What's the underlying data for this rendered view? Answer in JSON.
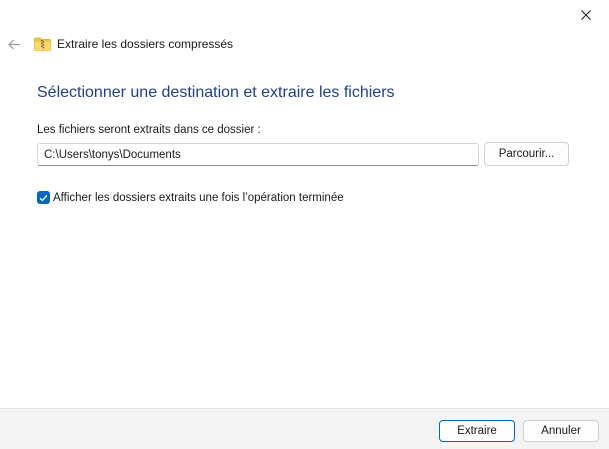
{
  "window": {
    "title": "Extraire les dossiers compressés",
    "close_icon": "close-icon",
    "back_icon": "back-arrow-icon",
    "folder_icon": "zip-folder-icon"
  },
  "main": {
    "heading": "Sélectionner une destination et extraire les fichiers",
    "destination_label": "Les fichiers seront extraits dans ce dossier :",
    "destination_value": "C:\\Users\\tonys\\Documents",
    "browse_label": "Parcourir...",
    "show_extracted_label": "Afficher les dossiers extraits une fois l’opération terminée",
    "show_extracted_checked": true
  },
  "footer": {
    "extract_label": "Extraire",
    "cancel_label": "Annuler"
  },
  "colors": {
    "accent": "#0067c0",
    "heading": "#1f3f8f",
    "footer_bg": "#f3f3f3"
  }
}
